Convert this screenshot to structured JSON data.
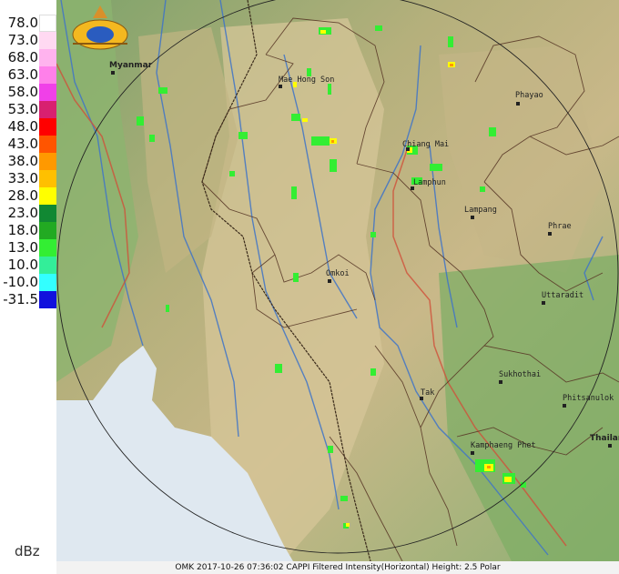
{
  "legend": {
    "unit": "dBz",
    "entries": [
      {
        "label": "78.0",
        "color": "#ffffff"
      },
      {
        "label": "73.0",
        "color": "#ffd9f2"
      },
      {
        "label": "68.0",
        "color": "#ffb3ee"
      },
      {
        "label": "63.0",
        "color": "#ff80ea"
      },
      {
        "label": "58.0",
        "color": "#f040e8"
      },
      {
        "label": "53.0",
        "color": "#d82070"
      },
      {
        "label": "48.0",
        "color": "#ff0000"
      },
      {
        "label": "43.0",
        "color": "#ff5500"
      },
      {
        "label": "38.0",
        "color": "#ff9900"
      },
      {
        "label": "33.0",
        "color": "#ffc000"
      },
      {
        "label": "28.0",
        "color": "#ffff00"
      },
      {
        "label": "23.0",
        "color": "#118833"
      },
      {
        "label": "18.0",
        "color": "#22aa22"
      },
      {
        "label": "13.0",
        "color": "#33ee33"
      },
      {
        "label": "10.0",
        "color": "#33ee99"
      },
      {
        "label": "-10.0",
        "color": "#33ffff"
      },
      {
        "label": "-31.5",
        "color": "#1111dd"
      }
    ]
  },
  "map": {
    "cities": [
      {
        "name": "Mae Hong Son",
        "id": "mae-hong-son"
      },
      {
        "name": "Chiang Mai",
        "id": "chiang-mai"
      },
      {
        "name": "Lamphun",
        "id": "lamphun"
      },
      {
        "name": "Lampang",
        "id": "lampang"
      },
      {
        "name": "Phayao",
        "id": "phayao"
      },
      {
        "name": "Phrae",
        "id": "phrae"
      },
      {
        "name": "Omkoi",
        "id": "omkoi"
      },
      {
        "name": "Uttaradit",
        "id": "uttaradit"
      },
      {
        "name": "Sukhothai",
        "id": "sukhothai"
      },
      {
        "name": "Phitsanulok",
        "id": "phitsanulok"
      },
      {
        "name": "Tak",
        "id": "tak"
      },
      {
        "name": "Kamphaeng Phet",
        "id": "kamphaeng-phet"
      }
    ],
    "countries": [
      {
        "name": "Myanmar",
        "id": "myanmar"
      },
      {
        "name": "Thailand",
        "id": "thailand"
      }
    ]
  },
  "footer": {
    "caption": "OMK 2017-10-26 07:36:02 CAPPI Filtered Intensity(Horizontal)  Height: 2.5 Polar"
  }
}
